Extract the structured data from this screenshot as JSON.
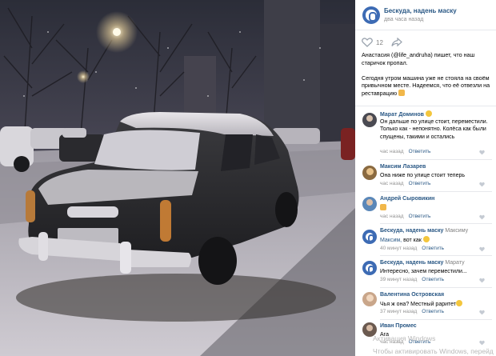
{
  "post": {
    "group_name": "Бескуда, надень маску",
    "time": "два часа назад",
    "likes": "12",
    "text_line1": "Анастасия (@life_andruha) пишет, что наш старичок пропал.",
    "text_line2": "Сегодня утром машина уже не стояла на своём привычном месте. Надеемся, что её отвезли на реставрацию"
  },
  "comments": [
    {
      "author": "Марат Доминов",
      "text": "Он дальше по улице стоит, переместили. Только как - непонятно. Колёса как были спущены, такими и остались",
      "time": "час назад",
      "reply": "Ответить"
    },
    {
      "author": "Максим Лазарев",
      "text": "Она ниже по улице стоит теперь",
      "time": "час назад",
      "reply": "Ответить"
    },
    {
      "author": "Андрей Сыровикин",
      "text": "",
      "time": "час назад",
      "reply": "Ответить"
    },
    {
      "author": "Бескуда, надень маску",
      "reply_to": "Максиму",
      "mention": "Максим,",
      "text": " вот как",
      "time": "40 минут назад",
      "reply": "Ответить"
    },
    {
      "author": "Бескуда, надень маску",
      "reply_to": "Марату",
      "text": "Интересно, зачем переместили...",
      "time": "39 минут назад",
      "reply": "Ответить"
    },
    {
      "author": "Валентина Островская",
      "text": "Чья ж она? Местный раритет",
      "time": "37 минут назад",
      "reply": "Ответить"
    },
    {
      "author": "Иван Промес",
      "text": "Ага",
      "time": "час назад",
      "reply": "Ответить"
    }
  ],
  "os_watermark": {
    "line1": "Активация Windows",
    "line2": "Чтобы активировать Windows, перейд"
  },
  "colors": {
    "link": "#2a5885",
    "group_avatar": "#3d6bb4",
    "meta": "#939393"
  },
  "icons": [
    "heart-icon",
    "share-icon",
    "like-small-icon"
  ]
}
